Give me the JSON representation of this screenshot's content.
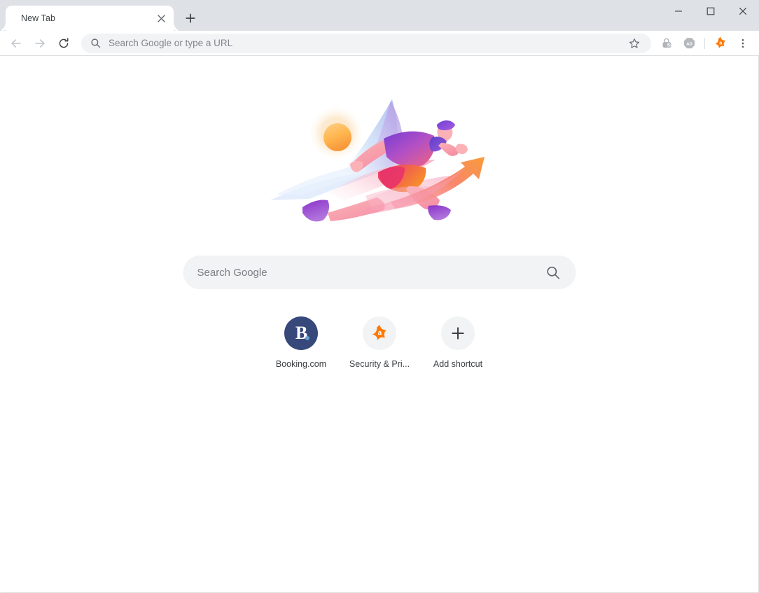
{
  "window": {
    "controls": [
      {
        "name": "minimize",
        "glyph": "minimize-icon"
      },
      {
        "name": "maximize",
        "glyph": "maximize-icon"
      },
      {
        "name": "close",
        "glyph": "close-icon"
      }
    ]
  },
  "tabstrip": {
    "tabs": [
      {
        "title": "New Tab",
        "active": true,
        "close_label": "close-tab-icon"
      }
    ],
    "new_tab_label": "new-tab-icon"
  },
  "toolbar": {
    "back_label": "back-arrow-icon",
    "forward_label": "forward-arrow-icon",
    "reload_label": "reload-icon",
    "omnibox": {
      "placeholder": "Search Google or type a URL",
      "value": "",
      "search_icon": "search-icon",
      "bookmark_icon": "star-icon"
    },
    "extensions": [
      {
        "name": "password-manager-extension",
        "icon": "lock-check-icon"
      },
      {
        "name": "ad-blocker-extension",
        "icon": "ad-block-icon",
        "text": "AD"
      },
      {
        "name": "avast-extension",
        "icon": "avast-logo-icon"
      }
    ],
    "menu_label": "three-dot-menu-icon"
  },
  "newtab": {
    "hero": {
      "name": "running-figure-illustration",
      "colors": {
        "sun_inner": "#ffb347",
        "sun_outer": "#fde9c8",
        "blue": "#b8cff0",
        "lavender": "#c3b0e8",
        "pink": "#f79ab0",
        "magenta": "#e8417a",
        "purple": "#8b3fd6",
        "orange": "#f58220",
        "coral": "#f98a7a"
      }
    },
    "search": {
      "placeholder": "Search Google",
      "value": "",
      "icon": "search-icon"
    },
    "shortcuts": [
      {
        "label": "Booking.com",
        "name": "shortcut-booking",
        "icon": "booking-logo-icon",
        "tile_color": "#37487a"
      },
      {
        "label": "Security & Pri...",
        "name": "shortcut-security-privacy",
        "icon": "avast-logo-icon",
        "tile_color": "#f1f3f4"
      },
      {
        "label": "Add shortcut",
        "name": "shortcut-add",
        "icon": "plus-icon",
        "tile_color": "#f1f3f4"
      }
    ]
  },
  "theme": {
    "chrome_frame": "#dee1e6",
    "toolbar_bg": "#ffffff",
    "omnibox_bg": "#f1f3f4",
    "text": "#3c4043",
    "muted_text": "#80868b"
  }
}
